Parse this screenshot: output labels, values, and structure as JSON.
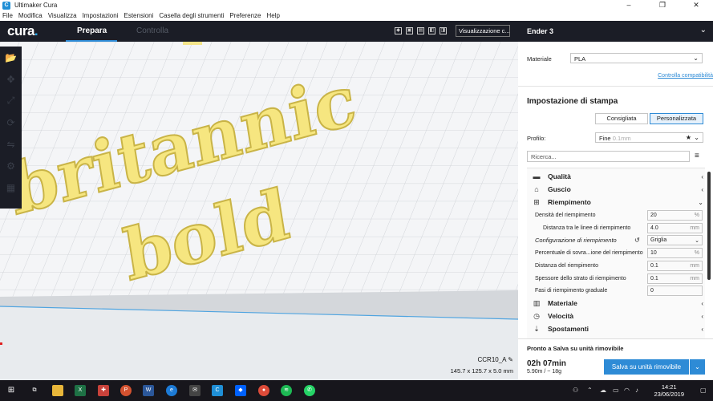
{
  "window": {
    "title": "Ultimaker Cura"
  },
  "menu": [
    "File",
    "Modifica",
    "Visualizza",
    "Impostazioni",
    "Estensioni",
    "Casella degli strumenti",
    "Preferenze",
    "Help"
  ],
  "header": {
    "logo": "cura",
    "tab_active": "Prepara",
    "tab_inactive": "Controlla",
    "view_select": "Visualizzazione c..."
  },
  "printer": {
    "name": "Ender 3"
  },
  "material": {
    "label": "Materiale",
    "value": "PLA",
    "check_link": "Controlla compatibilità"
  },
  "print_settings": {
    "title": "Impostazione di stampa",
    "btn_recommended": "Consigliata",
    "btn_custom": "Personalizzata",
    "profile_label": "Profilo:",
    "profile_value": "Fine",
    "profile_sub": "0.1mm",
    "search_placeholder": "Ricerca..."
  },
  "categories": {
    "quality": "Qualità",
    "shell": "Guscio",
    "infill": "Riempimento",
    "material": "Materiale",
    "speed": "Velocità",
    "travel": "Spostamenti"
  },
  "infill_settings": [
    {
      "label": "Densità del riempimento",
      "value": "20",
      "unit": "%"
    },
    {
      "label": "Distanza tra le linee di riempimento",
      "value": "4.0",
      "unit": "mm"
    },
    {
      "label": "Configurazione di riempimento",
      "value": "Griglia",
      "unit": ""
    },
    {
      "label": "Percentuale di sovra...ione del riempimento",
      "value": "10",
      "unit": "%"
    },
    {
      "label": "Distanza del riempimento",
      "value": "0.1",
      "unit": "mm"
    },
    {
      "label": "Spessore dello strato di riempimento",
      "value": "0.1",
      "unit": "mm"
    },
    {
      "label": "Fasi di riempimento graduale",
      "value": "0",
      "unit": ""
    }
  ],
  "object": {
    "name": "CCR10_A",
    "dims": "145.7 x 125.7 x 5.0 mm"
  },
  "model_text": {
    "line1": "britannic",
    "line2": "bold"
  },
  "output": {
    "ready": "Pronto a Salva su unità rimovibile",
    "time": "02h 07min",
    "material_usage": "5.90m / ~ 18g",
    "save_button": "Salva su unità rimovibile"
  },
  "taskbar": {
    "time": "14:21",
    "date": "23/06/2019"
  }
}
